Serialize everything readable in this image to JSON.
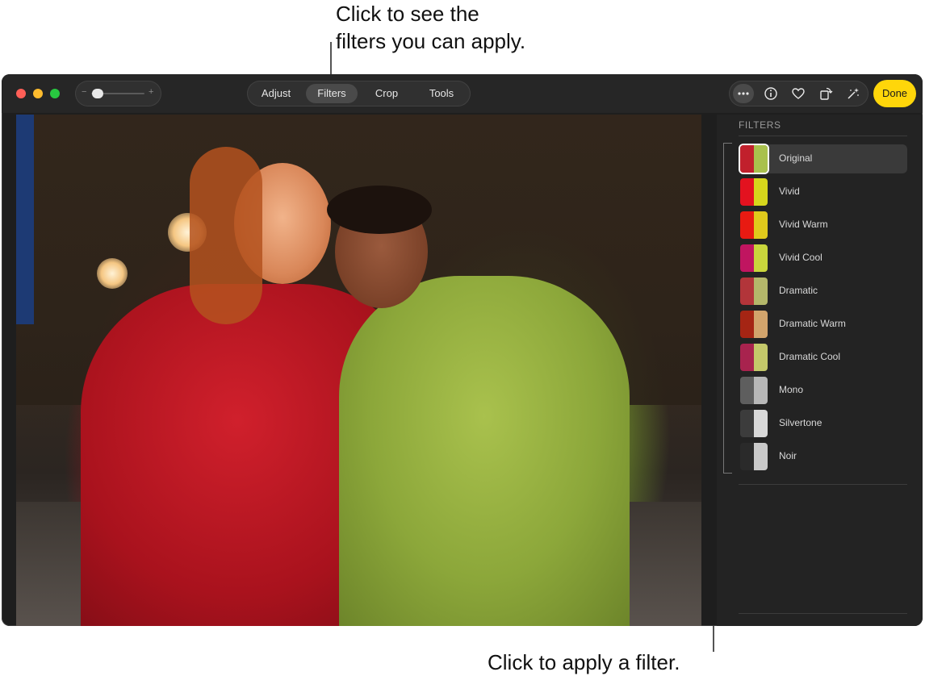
{
  "callouts": {
    "top_line1": "Click to see the",
    "top_line2": "filters you can apply.",
    "bottom": "Click to apply a filter."
  },
  "toolbar": {
    "zoom_minus": "−",
    "zoom_plus": "+",
    "tabs": [
      "Adjust",
      "Filters",
      "Crop",
      "Tools"
    ],
    "active_tab": "Filters",
    "tools": [
      "more-icon",
      "info-icon",
      "heart-icon",
      "rotate-icon",
      "auto-enhance-icon"
    ],
    "done_label": "Done"
  },
  "panel": {
    "title": "FILTERS",
    "filters": [
      {
        "label": "Original",
        "selected": true
      },
      {
        "label": "Vivid",
        "selected": false
      },
      {
        "label": "Vivid Warm",
        "selected": false
      },
      {
        "label": "Vivid Cool",
        "selected": false
      },
      {
        "label": "Dramatic",
        "selected": false
      },
      {
        "label": "Dramatic Warm",
        "selected": false
      },
      {
        "label": "Dramatic Cool",
        "selected": false
      },
      {
        "label": "Mono",
        "selected": false
      },
      {
        "label": "Silvertone",
        "selected": false
      },
      {
        "label": "Noir",
        "selected": false
      }
    ]
  },
  "colors": {
    "accent_done": "#ffd60a",
    "traffic_close": "#ff5f57",
    "traffic_minimize": "#febc2e",
    "traffic_zoom": "#28c840"
  }
}
